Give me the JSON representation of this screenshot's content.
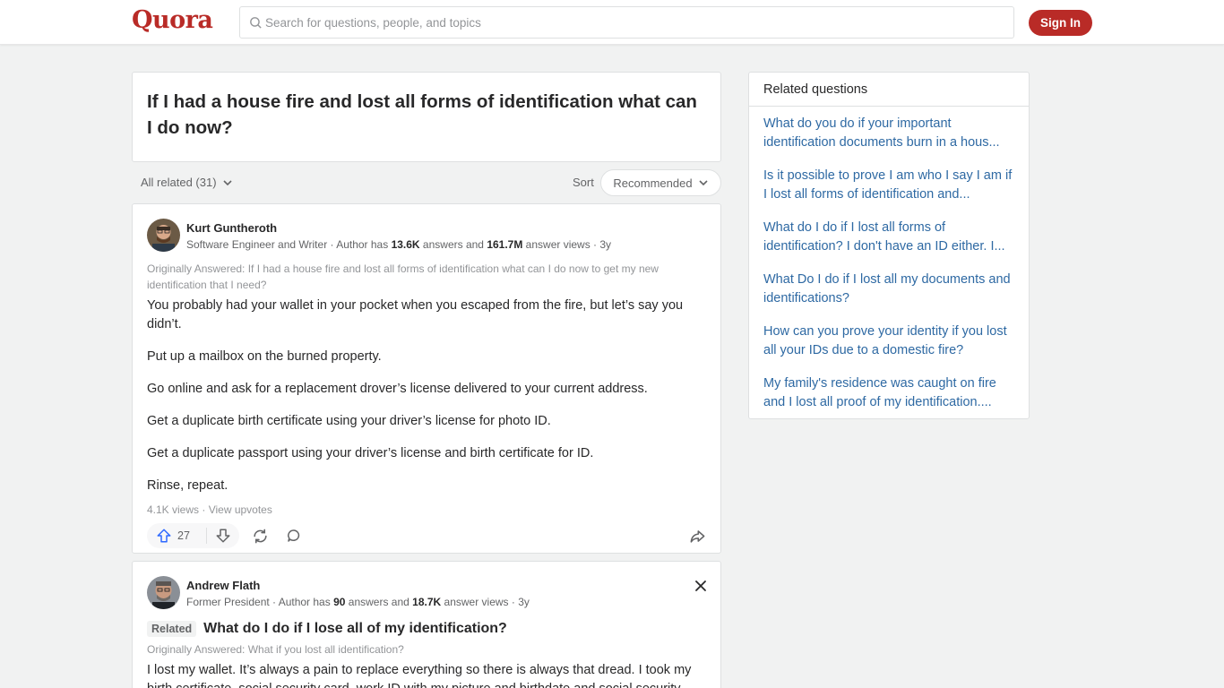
{
  "header": {
    "logo": "Quora",
    "search_placeholder": "Search for questions, people, and topics",
    "sign_in": "Sign In"
  },
  "question": {
    "title": "If I had a house fire and lost all forms of identification what can I do now?"
  },
  "filters": {
    "all_related": "All related (31)",
    "sort_label": "Sort",
    "sort_value": "Recommended"
  },
  "answers": [
    {
      "author": "Kurt Guntheroth",
      "meta_prefix": "Software Engineer and Writer · Author has ",
      "answers_count": "13.6K",
      "meta_mid1": " answers and ",
      "views_count": "161.7M",
      "meta_mid2": " answer views · 3y",
      "originally_answered": "Originally Answered: If I had a house fire and lost all forms of identification what can I do now to get my new identification that I need?",
      "paragraphs": [
        "You probably had your wallet in your pocket when you escaped from the fire, but let’s say you didn’t.",
        "Put up a mailbox on the burned property.",
        "Go online and ask for a replacement drover’s license delivered to your current address.",
        "Get a duplicate birth certificate using your driver’s license for photo ID.",
        "Get a duplicate passport using your driver’s license and birth certificate for ID.",
        "Rinse, repeat."
      ],
      "views": "4.1K views · View upvotes",
      "upvotes": "27"
    },
    {
      "author": "Andrew Flath",
      "meta_prefix": "Former President · Author has ",
      "answers_count": "90",
      "meta_mid1": " answers and ",
      "views_count": "18.7K",
      "meta_mid2": " answer views · 3y",
      "related_badge": "Related",
      "related_question": "What do I do if I lose all of my identification?",
      "originally_answered": "Originally Answered: What if you lost all identification?",
      "body": "I lost my wallet. It’s always a pain to replace everything so there is always that dread. I took my birth certificate, social security card, work ID with my picture and birthdate and social security"
    }
  ],
  "sidebar": {
    "title": "Related questions",
    "links": [
      "What do you do if your important identification documents burn in a hous...",
      "Is it possible to prove I am who I say I am if I lost all forms of identification and...",
      "What do I do if I lost all forms of identification? I don't have an ID either. I...",
      "What Do I do if I lost all my documents and identifications?",
      "How can you prove your identity if you lost all your IDs due to a domestic fire?",
      "My family's residence was caught on fire and I lost all proof of my identification...."
    ]
  },
  "colors": {
    "brand": "#b92b27",
    "link": "#2e69a3",
    "background": "#f1f2f2"
  }
}
